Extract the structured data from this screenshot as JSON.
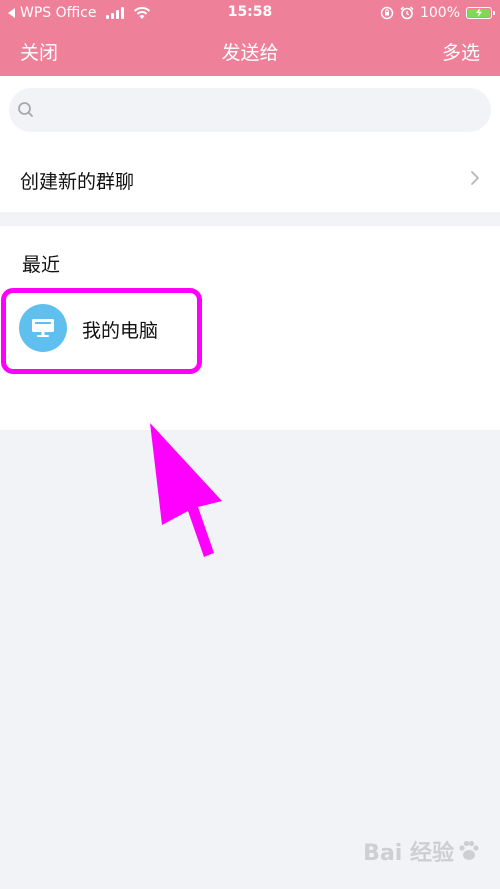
{
  "status_bar": {
    "carrier": "WPS Office",
    "time": "15:58",
    "battery": "100%",
    "battery_level": 1.0,
    "battery_color": "#7ed957"
  },
  "nav": {
    "close_label": "关闭",
    "title": "发送给",
    "multi_select_label": "多选",
    "background_color": "#ee8199"
  },
  "search": {
    "placeholder": "",
    "value": ""
  },
  "create_group": {
    "label": "创建新的群聊",
    "icon": "chevron-right-icon"
  },
  "recent": {
    "section_label": "最近",
    "items": [
      {
        "name": "我的电脑",
        "icon": "desktop-monitor-icon",
        "avatar_color": "#5fc0ef"
      }
    ]
  },
  "annotation": {
    "highlight_color": "#ff00ff"
  },
  "watermark": {
    "text": "Bai 经验"
  }
}
